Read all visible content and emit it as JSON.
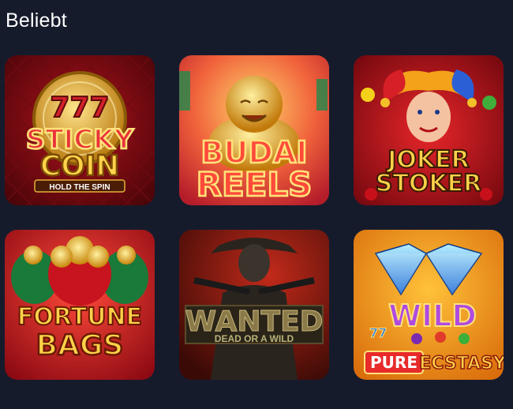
{
  "section": {
    "title": "Beliebt"
  },
  "games": [
    {
      "title_line1": "STICKY",
      "title_line2": "COIN",
      "subtitle": "HOLD THE SPIN",
      "badge": "777"
    },
    {
      "title_line1": "BUDAI",
      "title_line2": "REELS"
    },
    {
      "title_line1": "JOKER",
      "title_line2": "STOKER"
    },
    {
      "title_line1": "FORTUNE",
      "title_line2": "BAGS"
    },
    {
      "title_line1": "WANTED",
      "title_line2": "DEAD OR A WILD"
    },
    {
      "title_line1": "WILD",
      "title_line2": "PURE",
      "title_line3": "ECSTASY",
      "badge": "77"
    }
  ],
  "colors": {
    "background": "#161b2c",
    "title_text": "#ffffff"
  }
}
